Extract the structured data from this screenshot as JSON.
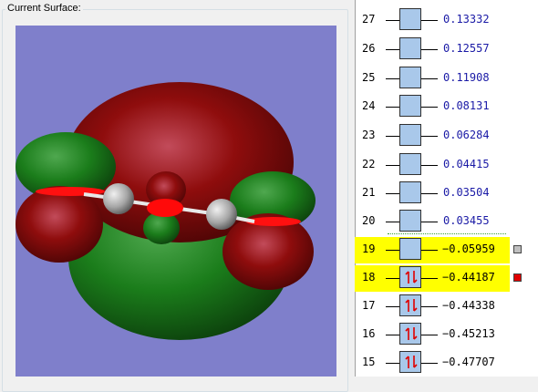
{
  "surface_panel": {
    "caption": "Current Surface:"
  },
  "mo_list": {
    "rows": [
      {
        "index": "27",
        "energy": "0.13332"
      },
      {
        "index": "26",
        "energy": "0.12557"
      },
      {
        "index": "25",
        "energy": "0.11908"
      },
      {
        "index": "24",
        "energy": "0.08131"
      },
      {
        "index": "23",
        "energy": "0.06284"
      },
      {
        "index": "22",
        "energy": "0.04415"
      },
      {
        "index": "21",
        "energy": "0.03504"
      },
      {
        "index": "20",
        "energy": "0.03455"
      },
      {
        "index": "19",
        "energy": "-0.05959",
        "highlight": true,
        "swatch": "#c0c0c0"
      },
      {
        "index": "18",
        "energy": "-0.44187",
        "highlight": true,
        "occupied": true,
        "swatch": "#e00000"
      },
      {
        "index": "17",
        "energy": "-0.44338",
        "occupied": true
      },
      {
        "index": "16",
        "energy": "-0.45213",
        "occupied": true
      },
      {
        "index": "15",
        "energy": "-0.47707",
        "occupied": true
      }
    ],
    "colors": {
      "virtual": "#1a1aa6",
      "highlight": "#ffff00",
      "box": "#a9c8ea",
      "electron_arrow": "#e00000"
    }
  },
  "viewport": {
    "background": "#7f7fcb",
    "lobe_positive": "#8b0a0a",
    "lobe_negative": "#1f7a1f",
    "atom": "#a8a8a8"
  }
}
